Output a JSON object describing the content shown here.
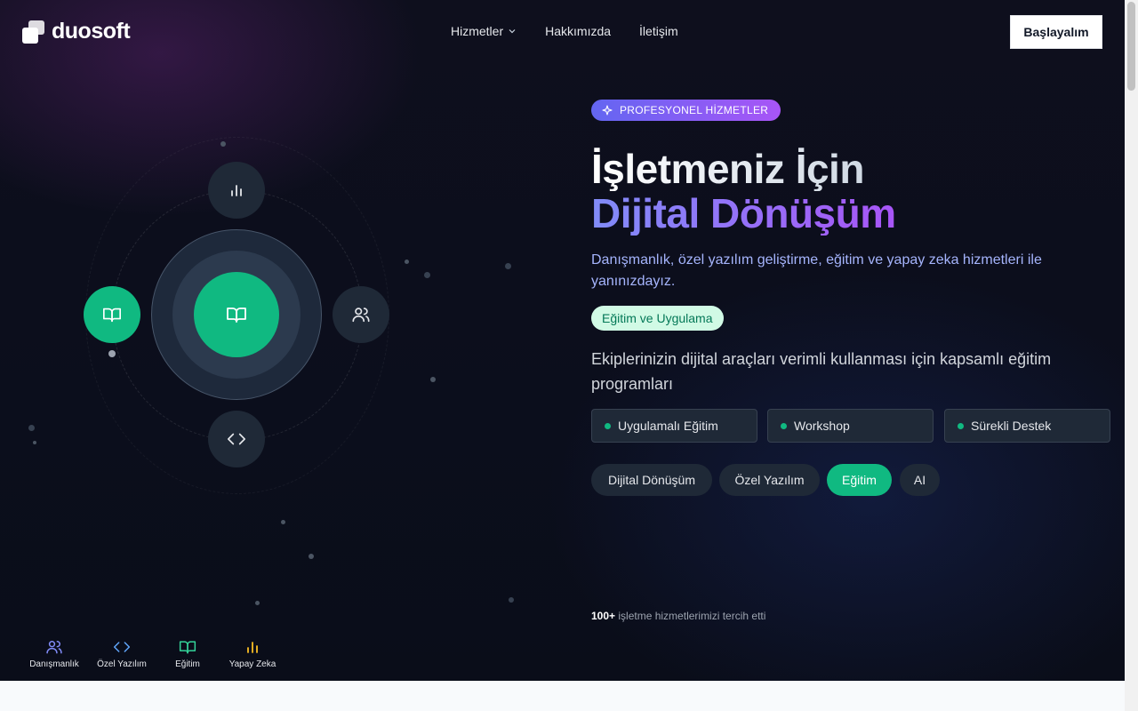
{
  "brand": {
    "name": "duosoft"
  },
  "nav": {
    "items": [
      {
        "label": "Hizmetler",
        "has_dropdown": true
      },
      {
        "label": "Hakkımızda"
      },
      {
        "label": "İletişim"
      }
    ],
    "cta_label": "Başlayalım"
  },
  "hero": {
    "badge": "PROFESYONEL HİZMETLER",
    "title_line1": "İşletmeniz İçin",
    "title_line2": "Dijital Dönüşüm",
    "subtitle": "Danışmanlık, özel yazılım geliştirme, eğitim ve yapay zeka hizmetleri ile yanınızdayız.",
    "service_tag": "Eğitim ve Uygulama",
    "service_desc": "Ekiplerinizin dijital araçları verimli kullanması için kapsamlı eğitim programları",
    "features": [
      "Uygulamalı Eğitim",
      "Workshop",
      "Sürekli Destek"
    ],
    "tabs": [
      {
        "label": "Dijital Dönüşüm",
        "active": false
      },
      {
        "label": "Özel Yazılım",
        "active": false
      },
      {
        "label": "Eğitim",
        "active": true
      },
      {
        "label": "AI",
        "active": false
      }
    ],
    "social_proof_count": "100+",
    "social_proof_text": "işletme hizmetlerimizi tercih etti"
  },
  "orbit": {
    "core_icon": "book-open-icon",
    "satellites": [
      "bar-chart-icon",
      "users-icon",
      "code-icon",
      "book-open-icon"
    ],
    "active_color": "#10b981"
  },
  "quick_nav": [
    {
      "label": "Danışmanlık",
      "icon": "users-icon",
      "color": "#818cf8"
    },
    {
      "label": "Özel Yazılım",
      "icon": "code-icon",
      "color": "#60a5fa"
    },
    {
      "label": "Eğitim",
      "icon": "book-open-icon",
      "color": "#34d399"
    },
    {
      "label": "Yapay Zeka",
      "icon": "bar-chart-icon",
      "color": "#fbbf24"
    }
  ]
}
